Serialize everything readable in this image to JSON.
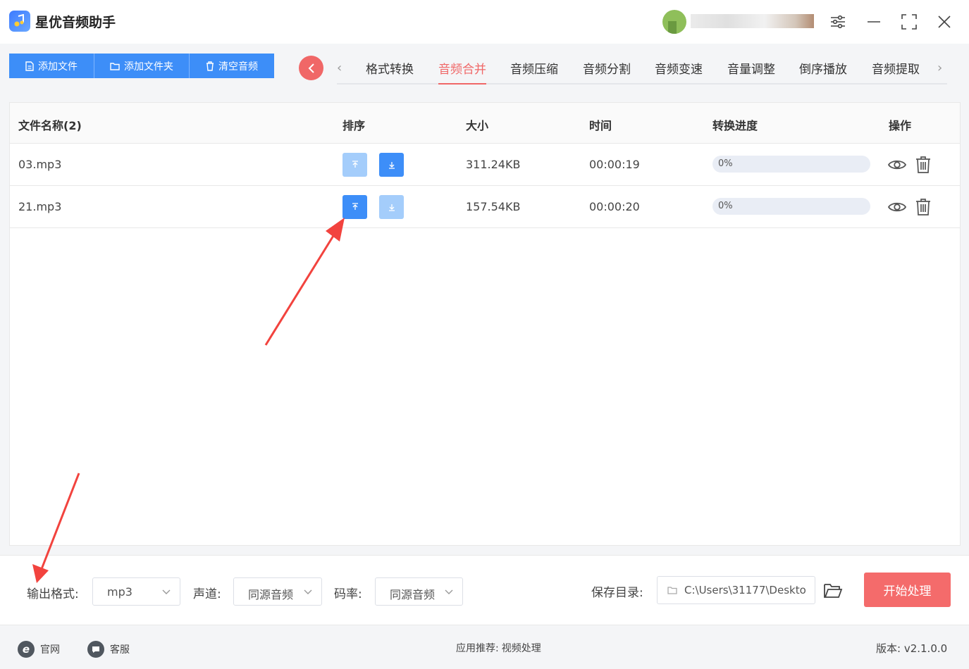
{
  "app": {
    "title": "星优音频助手"
  },
  "toolbar": {
    "add_file": "添加文件",
    "add_folder": "添加文件夹",
    "clear_audio": "清空音频"
  },
  "tabs": [
    {
      "label": "格式转换",
      "active": false
    },
    {
      "label": "音频合并",
      "active": true
    },
    {
      "label": "音频压缩",
      "active": false
    },
    {
      "label": "音频分割",
      "active": false
    },
    {
      "label": "音频变速",
      "active": false
    },
    {
      "label": "音量调整",
      "active": false
    },
    {
      "label": "倒序播放",
      "active": false
    },
    {
      "label": "音频提取",
      "active": false
    }
  ],
  "table": {
    "headers": {
      "name": "文件名称(2)",
      "sort": "排序",
      "size": "大小",
      "time": "时间",
      "progress": "转换进度",
      "ops": "操作"
    },
    "rows": [
      {
        "name": "03.mp3",
        "size": "311.24KB",
        "time": "00:00:19",
        "progress": "0%",
        "progress_value": 0,
        "up_enabled": false,
        "down_enabled": true
      },
      {
        "name": "21.mp3",
        "size": "157.54KB",
        "time": "00:00:20",
        "progress": "0%",
        "progress_value": 0,
        "up_enabled": true,
        "down_enabled": false
      }
    ]
  },
  "settings": {
    "format_label": "输出格式:",
    "format_value": "mp3",
    "channel_label": "声道:",
    "channel_value": "同源音频",
    "bitrate_label": "码率:",
    "bitrate_value": "同源音频",
    "save_label": "保存目录:",
    "save_path": "C:\\Users\\31177\\Deskto",
    "start_button": "开始处理"
  },
  "footer": {
    "website": "官网",
    "service": "客服",
    "recommend_label": "应用推荐:",
    "recommend_value": "视频处理",
    "version": "版本: v2.1.0.0"
  },
  "colors": {
    "primary": "#3d8ef8",
    "primary_disabled": "#a4cdfb",
    "accent": "#f06767",
    "start": "#f46b6b"
  }
}
